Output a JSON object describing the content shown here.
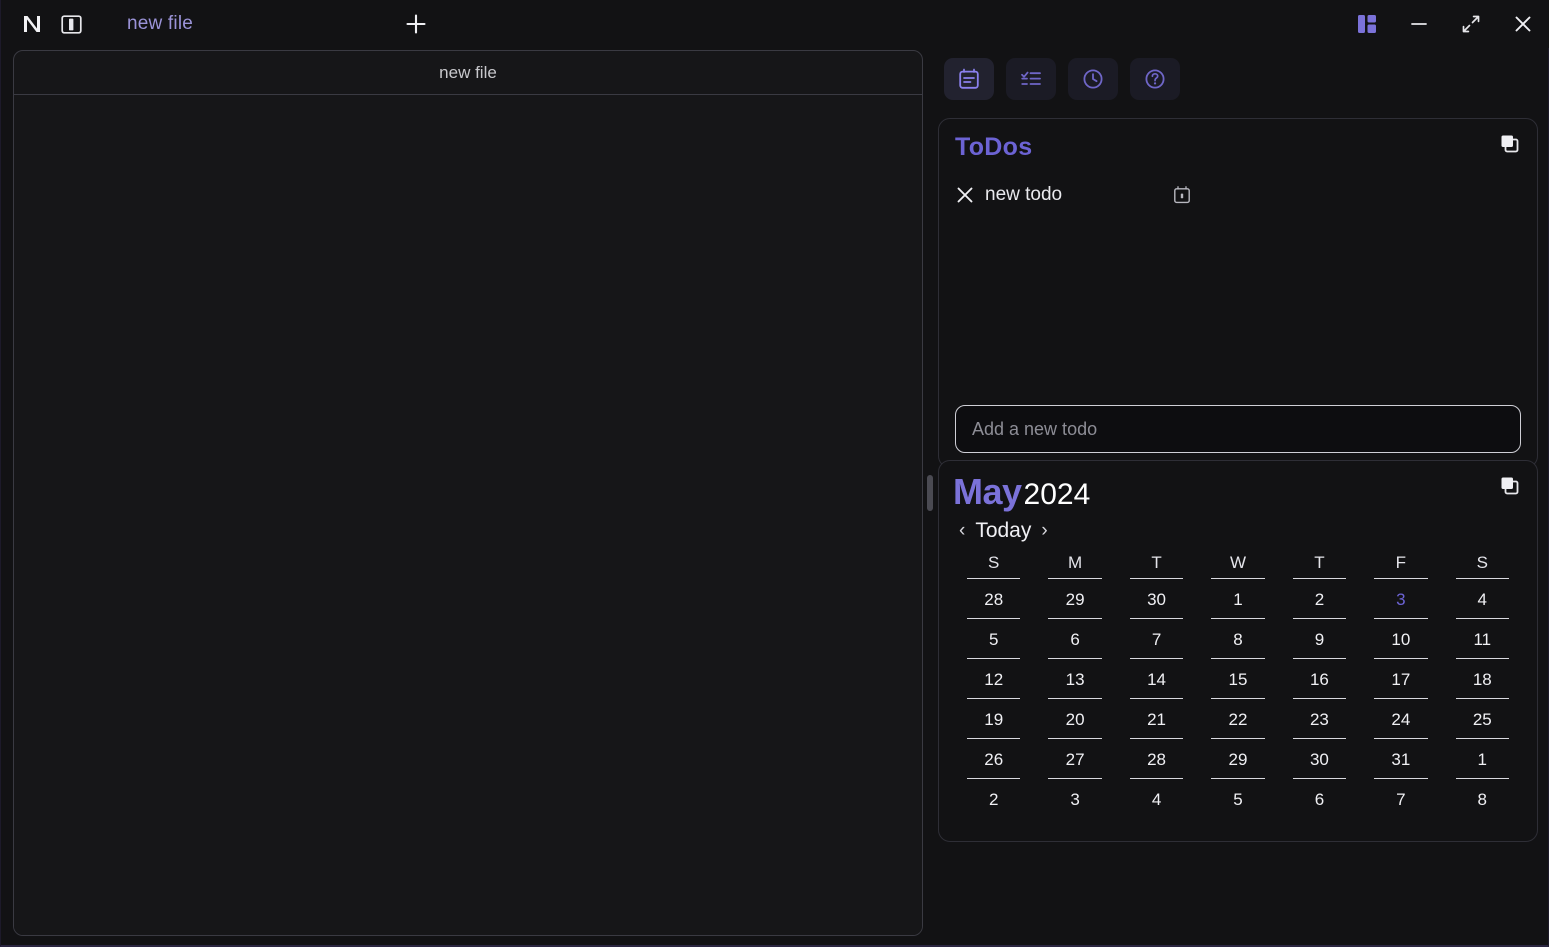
{
  "window": {
    "logo": "app-logo-n",
    "controls": [
      {
        "name": "layout-toggle-icon",
        "label": "layout"
      },
      {
        "name": "minimize-icon",
        "label": "minimize"
      },
      {
        "name": "maximize-icon",
        "label": "maximize"
      },
      {
        "name": "close-icon",
        "label": "close"
      }
    ]
  },
  "tabs": {
    "items": [
      {
        "label": "new file"
      }
    ],
    "new_tab_label": "+"
  },
  "editor": {
    "title": "new file",
    "content": ""
  },
  "toolbar": {
    "buttons": [
      {
        "icon": "notes-calendar-icon",
        "active": true
      },
      {
        "icon": "checklist-icon",
        "active": false
      },
      {
        "icon": "clock-icon",
        "active": false
      },
      {
        "icon": "help-icon",
        "active": false
      }
    ]
  },
  "todos": {
    "title": "ToDos",
    "copy_icon": "copy-icon",
    "items": [
      {
        "text": "new todo",
        "delete_icon": "close-icon",
        "date_icon": "calendar-icon"
      }
    ],
    "input_placeholder": "Add a new todo",
    "input_value": ""
  },
  "calendar": {
    "month": "May",
    "year": "2024",
    "copy_icon": "copy-icon",
    "prev_label": "‹",
    "today_label": "Today",
    "next_label": "›",
    "day_headers": [
      "S",
      "M",
      "T",
      "W",
      "T",
      "F",
      "S"
    ],
    "weeks": [
      [
        "28",
        "29",
        "30",
        "1",
        "2",
        "3",
        "4"
      ],
      [
        "5",
        "6",
        "7",
        "8",
        "9",
        "10",
        "11"
      ],
      [
        "12",
        "13",
        "14",
        "15",
        "16",
        "17",
        "18"
      ],
      [
        "19",
        "20",
        "21",
        "22",
        "23",
        "24",
        "25"
      ],
      [
        "26",
        "27",
        "28",
        "29",
        "30",
        "31",
        "1"
      ],
      [
        "2",
        "3",
        "4",
        "5",
        "6",
        "7",
        "8"
      ]
    ],
    "today_date": "3",
    "today_position": {
      "week": 0,
      "day": 5
    }
  },
  "colors": {
    "accent": "#6c63d4",
    "accent_light": "#7b72d9",
    "tab_text": "#9b93d8",
    "background": "#121214",
    "panel": "#161618"
  }
}
